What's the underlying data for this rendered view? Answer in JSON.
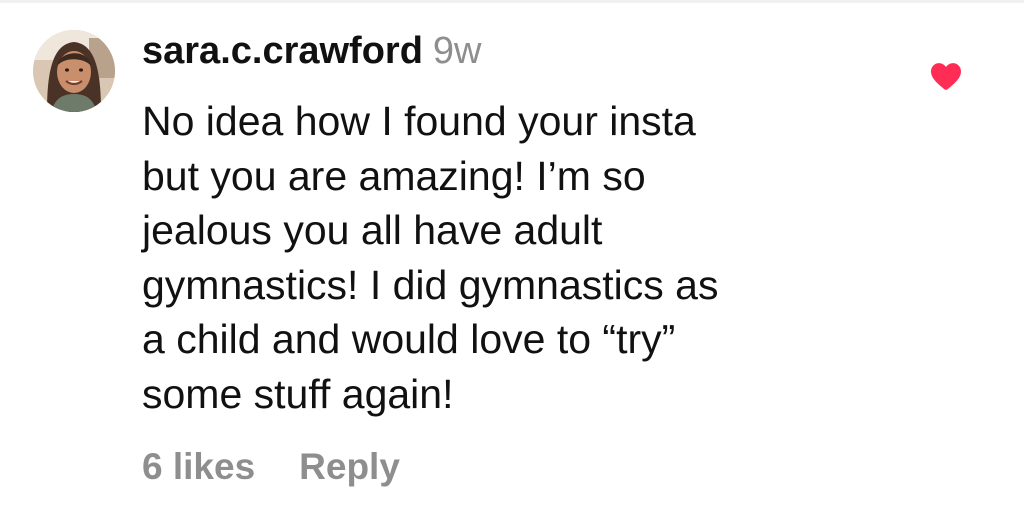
{
  "comment": {
    "username": "sara.c.crawford",
    "time_ago": "9w",
    "text_lines": [
      "No idea how I found your insta",
      "but you are amazing! I’m so",
      "jealous you all have adult",
      "gymnastics! I did gymnastics as",
      "a child and would love to “try”",
      "some stuff again!"
    ],
    "likes_label": "6 likes",
    "reply_label": "Reply",
    "liked": true
  },
  "icons": {
    "avatar": "profile-photo",
    "like": "heart-filled-icon"
  },
  "colors": {
    "text_primary": "#111111",
    "text_secondary": "#8e8e8e",
    "like_red": "#ff2d55",
    "background": "#ffffff"
  }
}
